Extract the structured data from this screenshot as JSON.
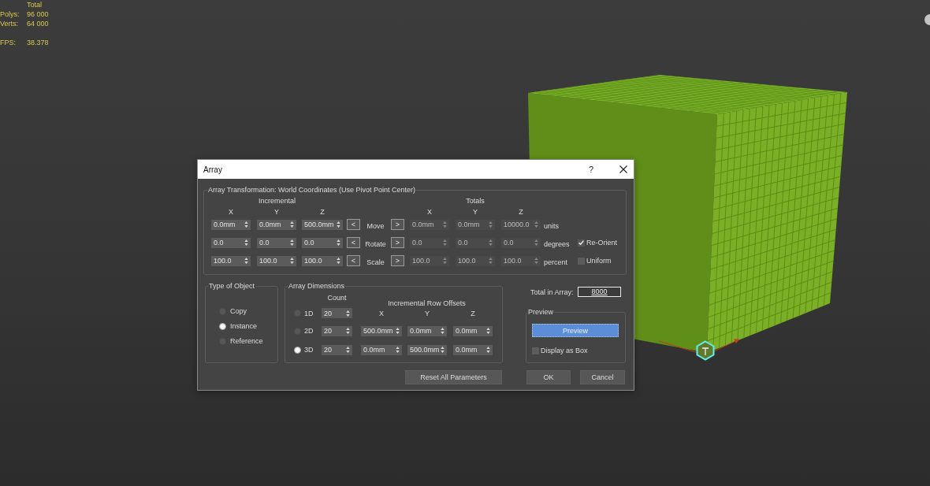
{
  "viewport": {
    "stats_header": "Total",
    "stats": [
      {
        "label": "Polys:",
        "value": "96 000"
      },
      {
        "label": "Verts:",
        "value": "64 000"
      }
    ],
    "fps": {
      "label": "FPS:",
      "value": "38.378"
    }
  },
  "dialog": {
    "title": "Array",
    "help": "?",
    "transformation": {
      "title": "Array Transformation: World Coordinates (Use Pivot Point Center)",
      "incremental_label": "Incremental",
      "totals_label": "Totals",
      "incremental_axes": [
        "X",
        "Y",
        "Z"
      ],
      "totals_axes": [
        "X",
        "Y",
        "Z"
      ],
      "totals_disabled": true,
      "rows": [
        {
          "label": "Move",
          "decrease": "<",
          "increase": ">",
          "incremental": [
            "0.0mm",
            "0.0mm",
            "500.0mm"
          ],
          "totals": [
            "0.0mm",
            "0.0mm",
            "10000.0"
          ],
          "unit": "units"
        },
        {
          "label": "Rotate",
          "decrease": "<",
          "increase": ">",
          "incremental": [
            "0.0",
            "0.0",
            "0.0"
          ],
          "totals": [
            "0.0",
            "0.0",
            "0.0"
          ],
          "unit": "degrees",
          "option": {
            "label": "Re-Orient",
            "checked": true
          }
        },
        {
          "label": "Scale",
          "decrease": "<",
          "increase": ">",
          "incremental": [
            "100.0",
            "100.0",
            "100.0"
          ],
          "totals": [
            "100.0",
            "100.0",
            "100.0"
          ],
          "unit": "percent",
          "option": {
            "label": "Uniform",
            "checked": false
          }
        }
      ]
    },
    "type_of_object": {
      "title": "Type of Object",
      "options": [
        {
          "label": "Copy",
          "selected": false
        },
        {
          "label": "Instance",
          "selected": true
        },
        {
          "label": "Reference",
          "selected": false
        }
      ]
    },
    "array_dimensions": {
      "title": "Array Dimensions",
      "count_label": "Count",
      "offsets_label": "Incremental Row Offsets",
      "axes": [
        "X",
        "Y",
        "Z"
      ],
      "rows": [
        {
          "label": "1D",
          "selected": false,
          "count": "20"
        },
        {
          "label": "2D",
          "selected": false,
          "count": "20",
          "offsets": [
            "500.0mm",
            "0.0mm",
            "0.0mm"
          ]
        },
        {
          "label": "3D",
          "selected": true,
          "count": "20",
          "offsets": [
            "0.0mm",
            "500.0mm",
            "0.0mm"
          ]
        }
      ]
    },
    "total_in_array": {
      "label": "Total in Array:",
      "value": "8000"
    },
    "preview": {
      "title": "Preview",
      "button": "Preview",
      "display_as_box": {
        "label": "Display as Box",
        "checked": false
      }
    },
    "buttons": [
      {
        "label": "Reset All Parameters",
        "kind": "reset"
      },
      {
        "label": "OK",
        "kind": "ok"
      },
      {
        "label": "Cancel",
        "kind": "cancel"
      }
    ]
  }
}
